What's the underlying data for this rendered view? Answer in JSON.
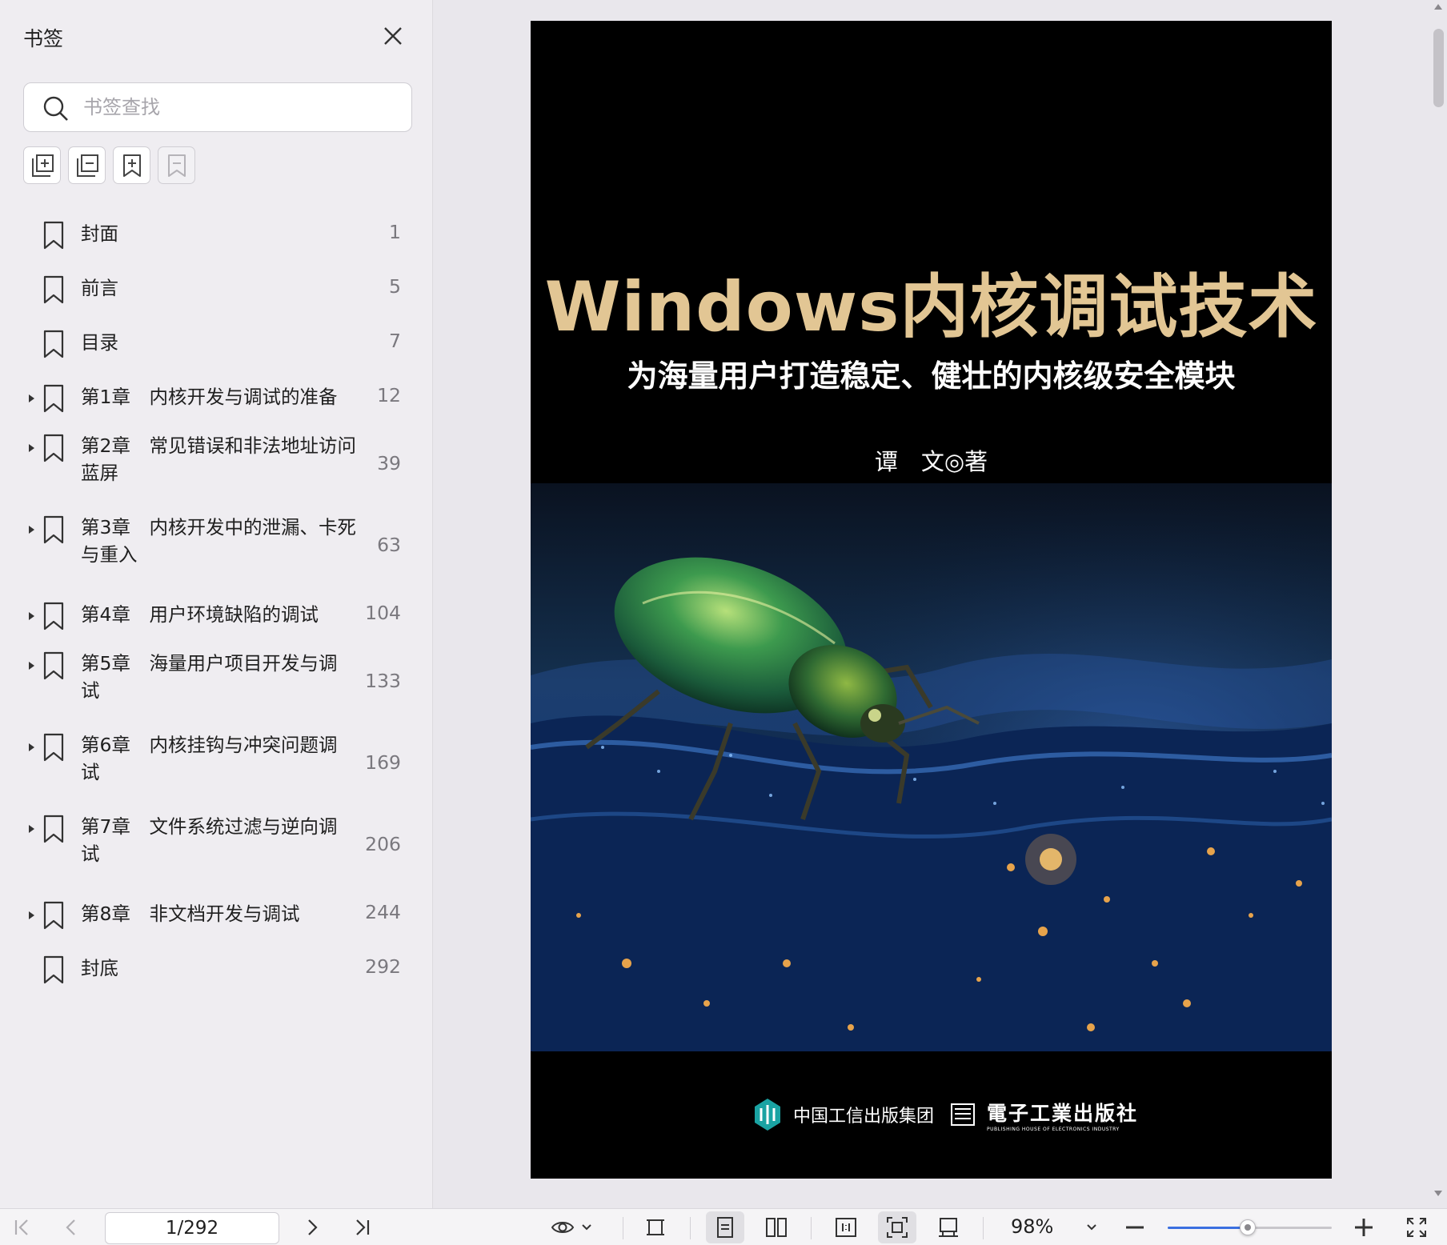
{
  "sidebar": {
    "title": "书签",
    "search": {
      "placeholder": "书签查找",
      "value": ""
    },
    "tools": [
      "expand-all-icon",
      "collapse-all-icon",
      "add-bookmark-icon",
      "remove-bookmark-icon"
    ],
    "items": [
      {
        "label": "封面",
        "page": "1",
        "has_children": false
      },
      {
        "label": "前言",
        "page": "5",
        "has_children": false
      },
      {
        "label": "目录",
        "page": "7",
        "has_children": false
      },
      {
        "label": "第1章　内核开发与调试的准备",
        "page": "12",
        "has_children": true
      },
      {
        "label": "第2章　常见错误和非法地址访问\n蓝屏",
        "page": "39",
        "has_children": true
      },
      {
        "label": "第3章　内核开发中的泄漏、卡死\n与重入",
        "page": "63",
        "has_children": true
      },
      {
        "label": "第4章　用户环境缺陷的调试",
        "page": "104",
        "has_children": true
      },
      {
        "label": "第5章　海量用户项目开发与调\n试",
        "page": "133",
        "has_children": true
      },
      {
        "label": "第6章　内核挂钩与冲突问题调\n试",
        "page": "169",
        "has_children": true
      },
      {
        "label": "第7章　文件系统过滤与逆向调\n试",
        "page": "206",
        "has_children": true
      },
      {
        "label": "第8章　非文档开发与调试",
        "page": "244",
        "has_children": true
      },
      {
        "label": "封底",
        "page": "292",
        "has_children": false
      }
    ]
  },
  "cover": {
    "title": "Windows内核调试技术",
    "subtitle": "为海量用户打造稳定、健壮的内核级安全模块",
    "author": "谭　文◎著",
    "publisher_1": "中国工信出版集团",
    "publisher_2": "電子工業出版社",
    "publisher_2_en": "PUBLISHING HOUSE OF ELECTRONICS INDUSTRY"
  },
  "toolbar": {
    "page_indicator": "1/292",
    "zoom": "98%",
    "zoom_fraction": 0.49
  },
  "colors": {
    "title_gold": "#e2c694",
    "accent_blue": "#3b6fe0",
    "sidebar_bg": "#efedf1"
  }
}
